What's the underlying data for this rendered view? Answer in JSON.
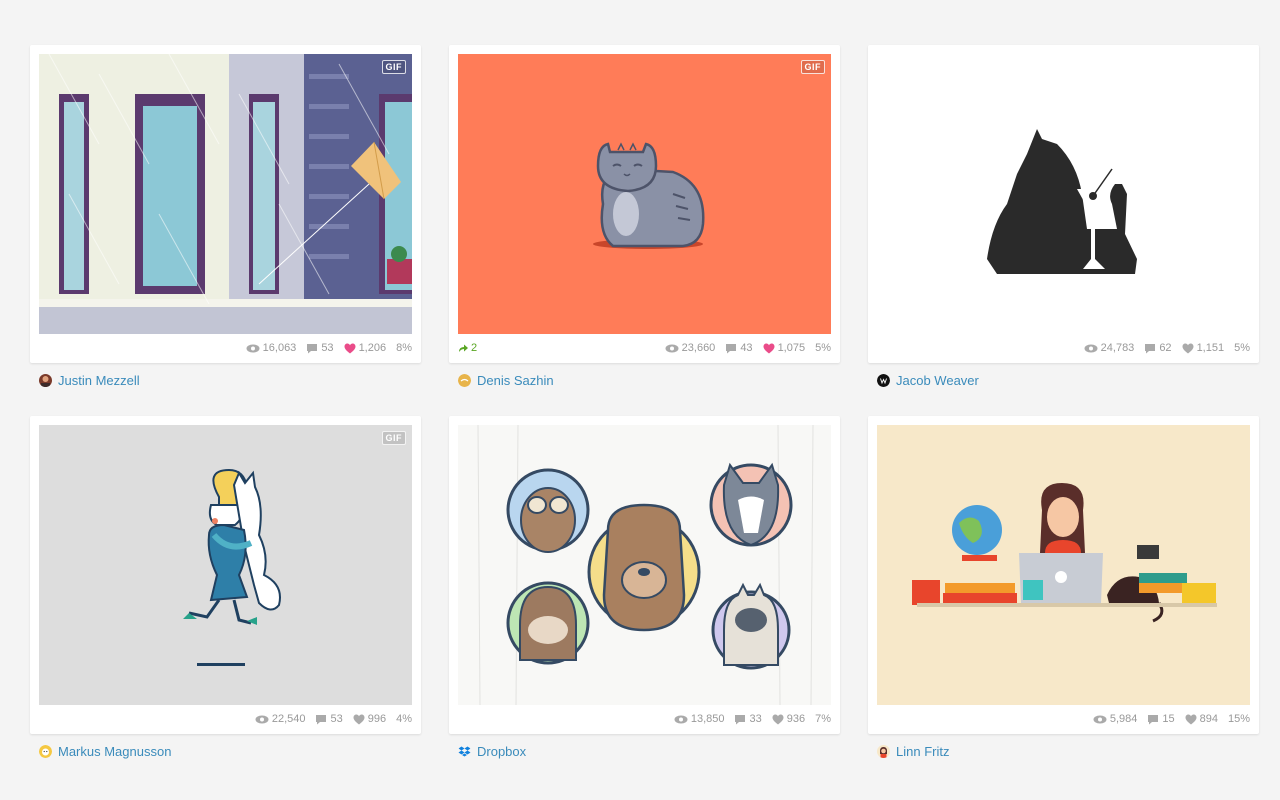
{
  "colors": {
    "link": "#3a8bbb",
    "like_active": "#ea4c89",
    "rebound": "#5aa624",
    "meta": "#999999"
  },
  "shots": [
    {
      "gif": "GIF",
      "views": "16,063",
      "comments": "53",
      "likes": "1,206",
      "liked": true,
      "percent": "8%",
      "author": "Justin Mezzell",
      "illustration": "rainy-building-kite"
    },
    {
      "gif": "GIF",
      "rebounds": "2",
      "views": "23,660",
      "comments": "43",
      "likes": "1,075",
      "liked": true,
      "percent": "5%",
      "author": "Denis Sazhin",
      "illustration": "gray-cat-orange"
    },
    {
      "views": "24,783",
      "comments": "62",
      "likes": "1,151",
      "liked": false,
      "percent": "5%",
      "author": "Jacob Weaver",
      "illustration": "cat-martini-logo"
    },
    {
      "gif": "GIF",
      "views": "22,540",
      "comments": "53",
      "likes": "996",
      "liked": false,
      "percent": "4%",
      "author": "Markus Magnusson",
      "illustration": "girl-hugging-cat"
    },
    {
      "views": "13,850",
      "comments": "33",
      "likes": "936",
      "liked": false,
      "percent": "7%",
      "author": "Dropbox",
      "illustration": "animal-portraits"
    },
    {
      "views": "5,984",
      "comments": "15",
      "likes": "894",
      "liked": false,
      "percent": "15%",
      "author": "Linn Fritz",
      "illustration": "girl-laptop-desk"
    }
  ],
  "icons": {
    "views": "eye-icon",
    "comments": "comment-icon",
    "likes": "heart-icon",
    "rebound": "rebound-icon"
  }
}
